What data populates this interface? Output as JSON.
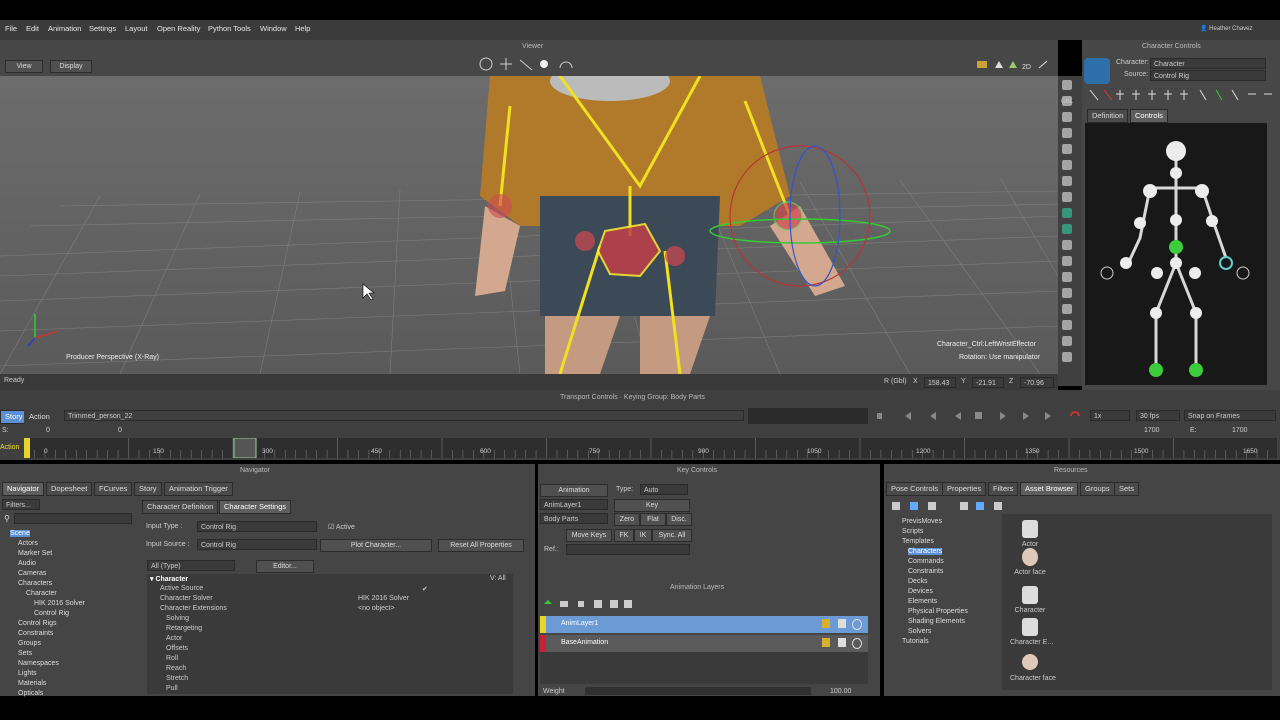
{
  "menubar": {
    "items": [
      "File",
      "Edit",
      "Animation",
      "Settings",
      "Layout",
      "Open Reality",
      "Python Tools",
      "Window",
      "Help"
    ],
    "user": "Heather Chavez"
  },
  "viewer": {
    "title": "Viewer",
    "view_btn": "View",
    "display_btn": "Display",
    "perspective_label": "Producer Perspective (X-Ray)",
    "effector_label": "Character_Ctrl:LeftWristEffector",
    "rotation_label": "Rotation: Use manipulator",
    "status": "Ready",
    "coords": {
      "mode": "R (Gbl)",
      "x_label": "X",
      "x": "158.43",
      "y_label": "Y",
      "y": "-21.91",
      "z_label": "Z",
      "z": "-70.96"
    }
  },
  "character_controls": {
    "title": "Character Controls",
    "character_label": "Character:",
    "character_value": "Character",
    "source_label": "Source:",
    "source_value": "Control Rig",
    "tabs": [
      "Definition",
      "Controls"
    ],
    "active_tab": "Controls",
    "side_label": "GBL"
  },
  "transport": {
    "title": "Transport Controls  ·  Keying Group: Body Parts",
    "story_tab": "Story",
    "action_tab": "Action",
    "take": "Trimmed_person_22",
    "speed": "1x",
    "fps": "30 fps",
    "snap": "Snap on Frames",
    "start_label": "S:",
    "start_value": "0",
    "cur_value": "0",
    "end_label_a": "1700",
    "end_label": "E:",
    "end_value": "1700",
    "action_label": "Action",
    "ticks": [
      "0",
      "150",
      "300",
      "450",
      "600",
      "750",
      "900",
      "1050",
      "1200",
      "1350",
      "1500",
      "1650"
    ],
    "playhead": "300"
  },
  "navigator": {
    "title": "Navigator",
    "tabs": [
      "Navigator",
      "Dopesheet",
      "FCurves",
      "Story",
      "Animation Trigger"
    ],
    "filters": "Filters...",
    "tree": [
      {
        "label": "Scene",
        "indent": 0,
        "selected": true
      },
      {
        "label": "Actors",
        "indent": 1
      },
      {
        "label": "Marker Set",
        "indent": 1
      },
      {
        "label": "Audio",
        "indent": 1
      },
      {
        "label": "Cameras",
        "indent": 1
      },
      {
        "label": "Characters",
        "indent": 1
      },
      {
        "label": "Character",
        "indent": 2
      },
      {
        "label": "HIK 2016 Solver",
        "indent": 3
      },
      {
        "label": "Control Rig",
        "indent": 3
      },
      {
        "label": "Control Rigs",
        "indent": 1
      },
      {
        "label": "Constraints",
        "indent": 1
      },
      {
        "label": "Groups",
        "indent": 1
      },
      {
        "label": "Sets",
        "indent": 1
      },
      {
        "label": "Namespaces",
        "indent": 1
      },
      {
        "label": "Lights",
        "indent": 1
      },
      {
        "label": "Materials",
        "indent": 1
      },
      {
        "label": "Opticals",
        "indent": 1
      }
    ],
    "sub_tabs": [
      "Character Definition",
      "Character Settings"
    ],
    "input_type_label": "Input Type :",
    "input_type_value": "Control Rig",
    "active_label": "Active",
    "input_source_label": "Input Source :",
    "input_source_value": "Control Rig",
    "plot_btn": "Plot Character...",
    "reset_btn": "Reset All Properties",
    "type_filter": "All (Type)",
    "editor_btn": "Editor...",
    "props_header": "Character",
    "props_header_right": "V: All",
    "props": [
      {
        "label": "Active Source",
        "value": "✔"
      },
      {
        "label": "Character Solver",
        "value": "HIK 2016 Solver"
      },
      {
        "label": "Character Extensions",
        "value": "<no object>"
      },
      {
        "label": "Solving",
        "value": ""
      },
      {
        "label": "Retargeting",
        "value": ""
      },
      {
        "label": "Actor",
        "value": ""
      },
      {
        "label": "Offsets",
        "value": ""
      },
      {
        "label": "Roll",
        "value": ""
      },
      {
        "label": "Reach",
        "value": ""
      },
      {
        "label": "Stretch",
        "value": ""
      },
      {
        "label": "Pull",
        "value": ""
      }
    ]
  },
  "key_controls": {
    "title": "Key Controls",
    "animation_btn": "Animation",
    "type_label": "Type:",
    "type_value": "Auto",
    "layer_value": "AnimLayer1",
    "key_btn": "Key",
    "body_parts_value": "Body Parts",
    "zero_btn": "Zero",
    "flat_btn": "Flat",
    "disc_btn": "Disc.",
    "move_keys_btn": "Move Keys",
    "fk_btn": "FK",
    "ik_btn": "IK",
    "sync_btn": "Sync. All",
    "ref_label": "Ref.:",
    "layers_title": "Animation Layers",
    "layers": [
      {
        "name": "AnimLayer1",
        "color": "#e8d52a",
        "selected": true
      },
      {
        "name": "BaseAnimation",
        "color": "#c8203a",
        "selected": false
      }
    ],
    "weight_label": "Weight",
    "weight_value": "100.00"
  },
  "resources": {
    "title": "Resources",
    "tabs": [
      "Pose Controls",
      "Properties",
      "Filters",
      "Asset Browser",
      "Groups",
      "Sets"
    ],
    "active_tab": "Asset Browser",
    "tree": [
      {
        "label": "PrevisMoves",
        "indent": 1
      },
      {
        "label": "Scripts",
        "indent": 1
      },
      {
        "label": "Templates",
        "indent": 1
      },
      {
        "label": "Characters",
        "indent": 2,
        "selected": true
      },
      {
        "label": "Commands",
        "indent": 2
      },
      {
        "label": "Constraints",
        "indent": 2
      },
      {
        "label": "Decks",
        "indent": 2
      },
      {
        "label": "Devices",
        "indent": 2
      },
      {
        "label": "Elements",
        "indent": 2
      },
      {
        "label": "Physical Properties",
        "indent": 2
      },
      {
        "label": "Shading Elements",
        "indent": 2
      },
      {
        "label": "Solvers",
        "indent": 2
      },
      {
        "label": "Tutorials",
        "indent": 1
      }
    ],
    "assets": [
      "Actor",
      "Actor face",
      "Character",
      "Character E...",
      "Character face"
    ]
  },
  "colors": {
    "bg": "#3d3d3d",
    "panel": "#454545",
    "selected": "#5b8fd6",
    "accent_yellow": "#e8d52a",
    "accent_red": "#c8203a"
  }
}
